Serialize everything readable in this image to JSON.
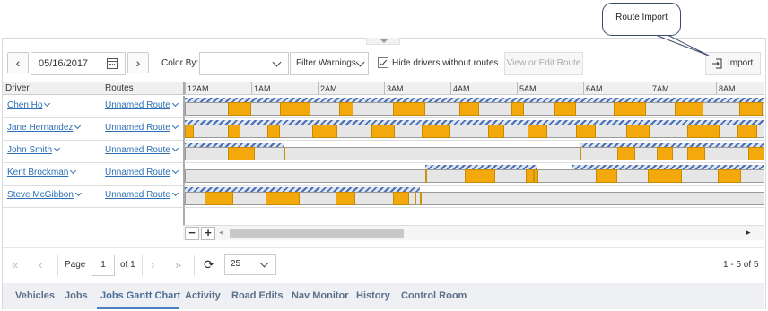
{
  "callout": {
    "text": "Route Import"
  },
  "toolbar": {
    "prev_glyph": "‹",
    "next_glyph": "›",
    "date_value": "05/16/2017",
    "color_by_label": "Color By:",
    "color_by_value": "",
    "filter_warnings_label": "Filter Warnings",
    "hide_drivers_label": "Hide drivers without routes",
    "hide_drivers_checked": true,
    "view_edit_route_label": "View or Edit Route",
    "import_label": "Import"
  },
  "grid": {
    "driver_header": "Driver",
    "routes_header": "Routes",
    "hours": [
      "12AM",
      "1AM",
      "2AM",
      "3AM",
      "4AM",
      "5AM",
      "6AM",
      "7AM",
      "8AM"
    ],
    "rows": [
      {
        "driver": "Chen Ho",
        "route": "Unnamed Route"
      },
      {
        "driver": "Jane Hernandez",
        "route": "Unnamed Route"
      },
      {
        "driver": "John Smith",
        "route": "Unnamed Route"
      },
      {
        "driver": "Kent Brockman",
        "route": "Unnamed Route"
      },
      {
        "driver": "Steve McGibbon",
        "route": "Unnamed Route"
      }
    ],
    "zoom_out": "−",
    "zoom_in": "+"
  },
  "pager": {
    "page_label": "Page",
    "page_value": "1",
    "of_label": "of 1",
    "page_size": "25",
    "summary": "1 - 5 of 5"
  },
  "tabs": [
    "Vehicles",
    "Jobs",
    "Jobs Gantt Chart",
    "Activity",
    "Road Edits",
    "Nav Monitor",
    "History",
    "Control Room"
  ],
  "active_tab": "Jobs Gantt Chart",
  "colors": {
    "stop": "#f3a90b",
    "hatch": "#4a6fb5",
    "link": "#2a6fb5",
    "tab_underline": "#4a7fc0"
  }
}
